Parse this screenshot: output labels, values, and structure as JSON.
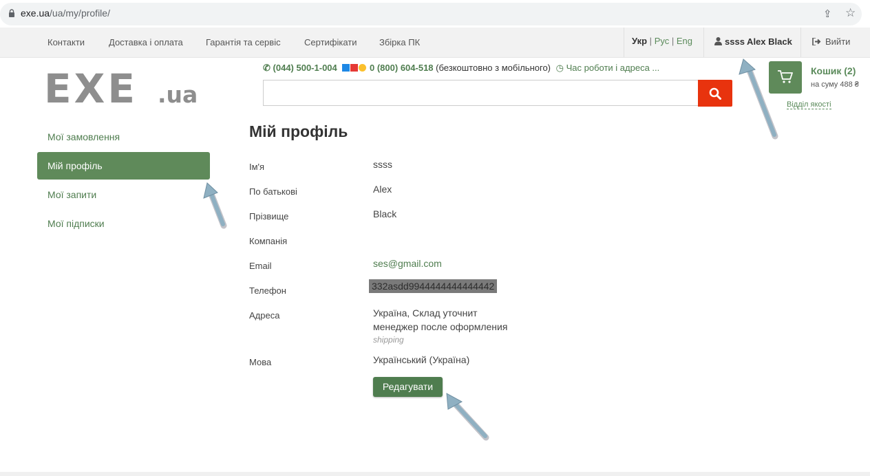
{
  "browser": {
    "url_host": "exe.ua",
    "url_path": "/ua/my/profile/"
  },
  "topnav": {
    "links": [
      "Контакти",
      "Доставка і оплата",
      "Гарантія та сервіс",
      "Сертифікати",
      "Збірка ПК"
    ],
    "lang_ukr": "Укр",
    "lang_rus": "Рус",
    "lang_eng": "Eng",
    "lang_sep": "|",
    "user": "ssss Alex Black",
    "logout": "Вийти"
  },
  "header": {
    "logo_main": "EXE",
    "logo_suffix": ".ua",
    "phone1": "(044) 500-1-004",
    "phone2": "0 (800) 604-518",
    "phone2_note": "(безкоштовно з мобільного)",
    "hours": "Час роботи і адреса ...",
    "search_placeholder": "",
    "cart_title": "Кошик (2)",
    "cart_sum": "на суму 488 ₴",
    "quality": "Відділ якості"
  },
  "sidebar": {
    "items": [
      {
        "label": "Мої замовлення"
      },
      {
        "label": "Мій профіль"
      },
      {
        "label": "Мої запити"
      },
      {
        "label": "Мої підписки"
      }
    ]
  },
  "profile": {
    "title": "Мій профіль",
    "fields": [
      {
        "label": "Ім'я",
        "value": "ssss"
      },
      {
        "label": "По батькові",
        "value": "Alex"
      },
      {
        "label": "Прізвище",
        "value": "Black"
      },
      {
        "label": "Компанія",
        "value": ""
      },
      {
        "label": "Email",
        "value": "ses@gmail.com"
      },
      {
        "label": "Телефон",
        "value": "332asdd9944444444444442"
      },
      {
        "label": "Адреса",
        "value_line1": "Україна, Склад уточнит",
        "value_line2": "менеджер после оформления",
        "note": "shipping"
      },
      {
        "label": "Мова",
        "value": "Український (Україна)"
      }
    ],
    "edit_button": "Редагувати"
  },
  "colors": {
    "brand_green": "#5f8a5a",
    "search_red": "#e8330e",
    "arrow_blue": "#8fb0c2"
  }
}
